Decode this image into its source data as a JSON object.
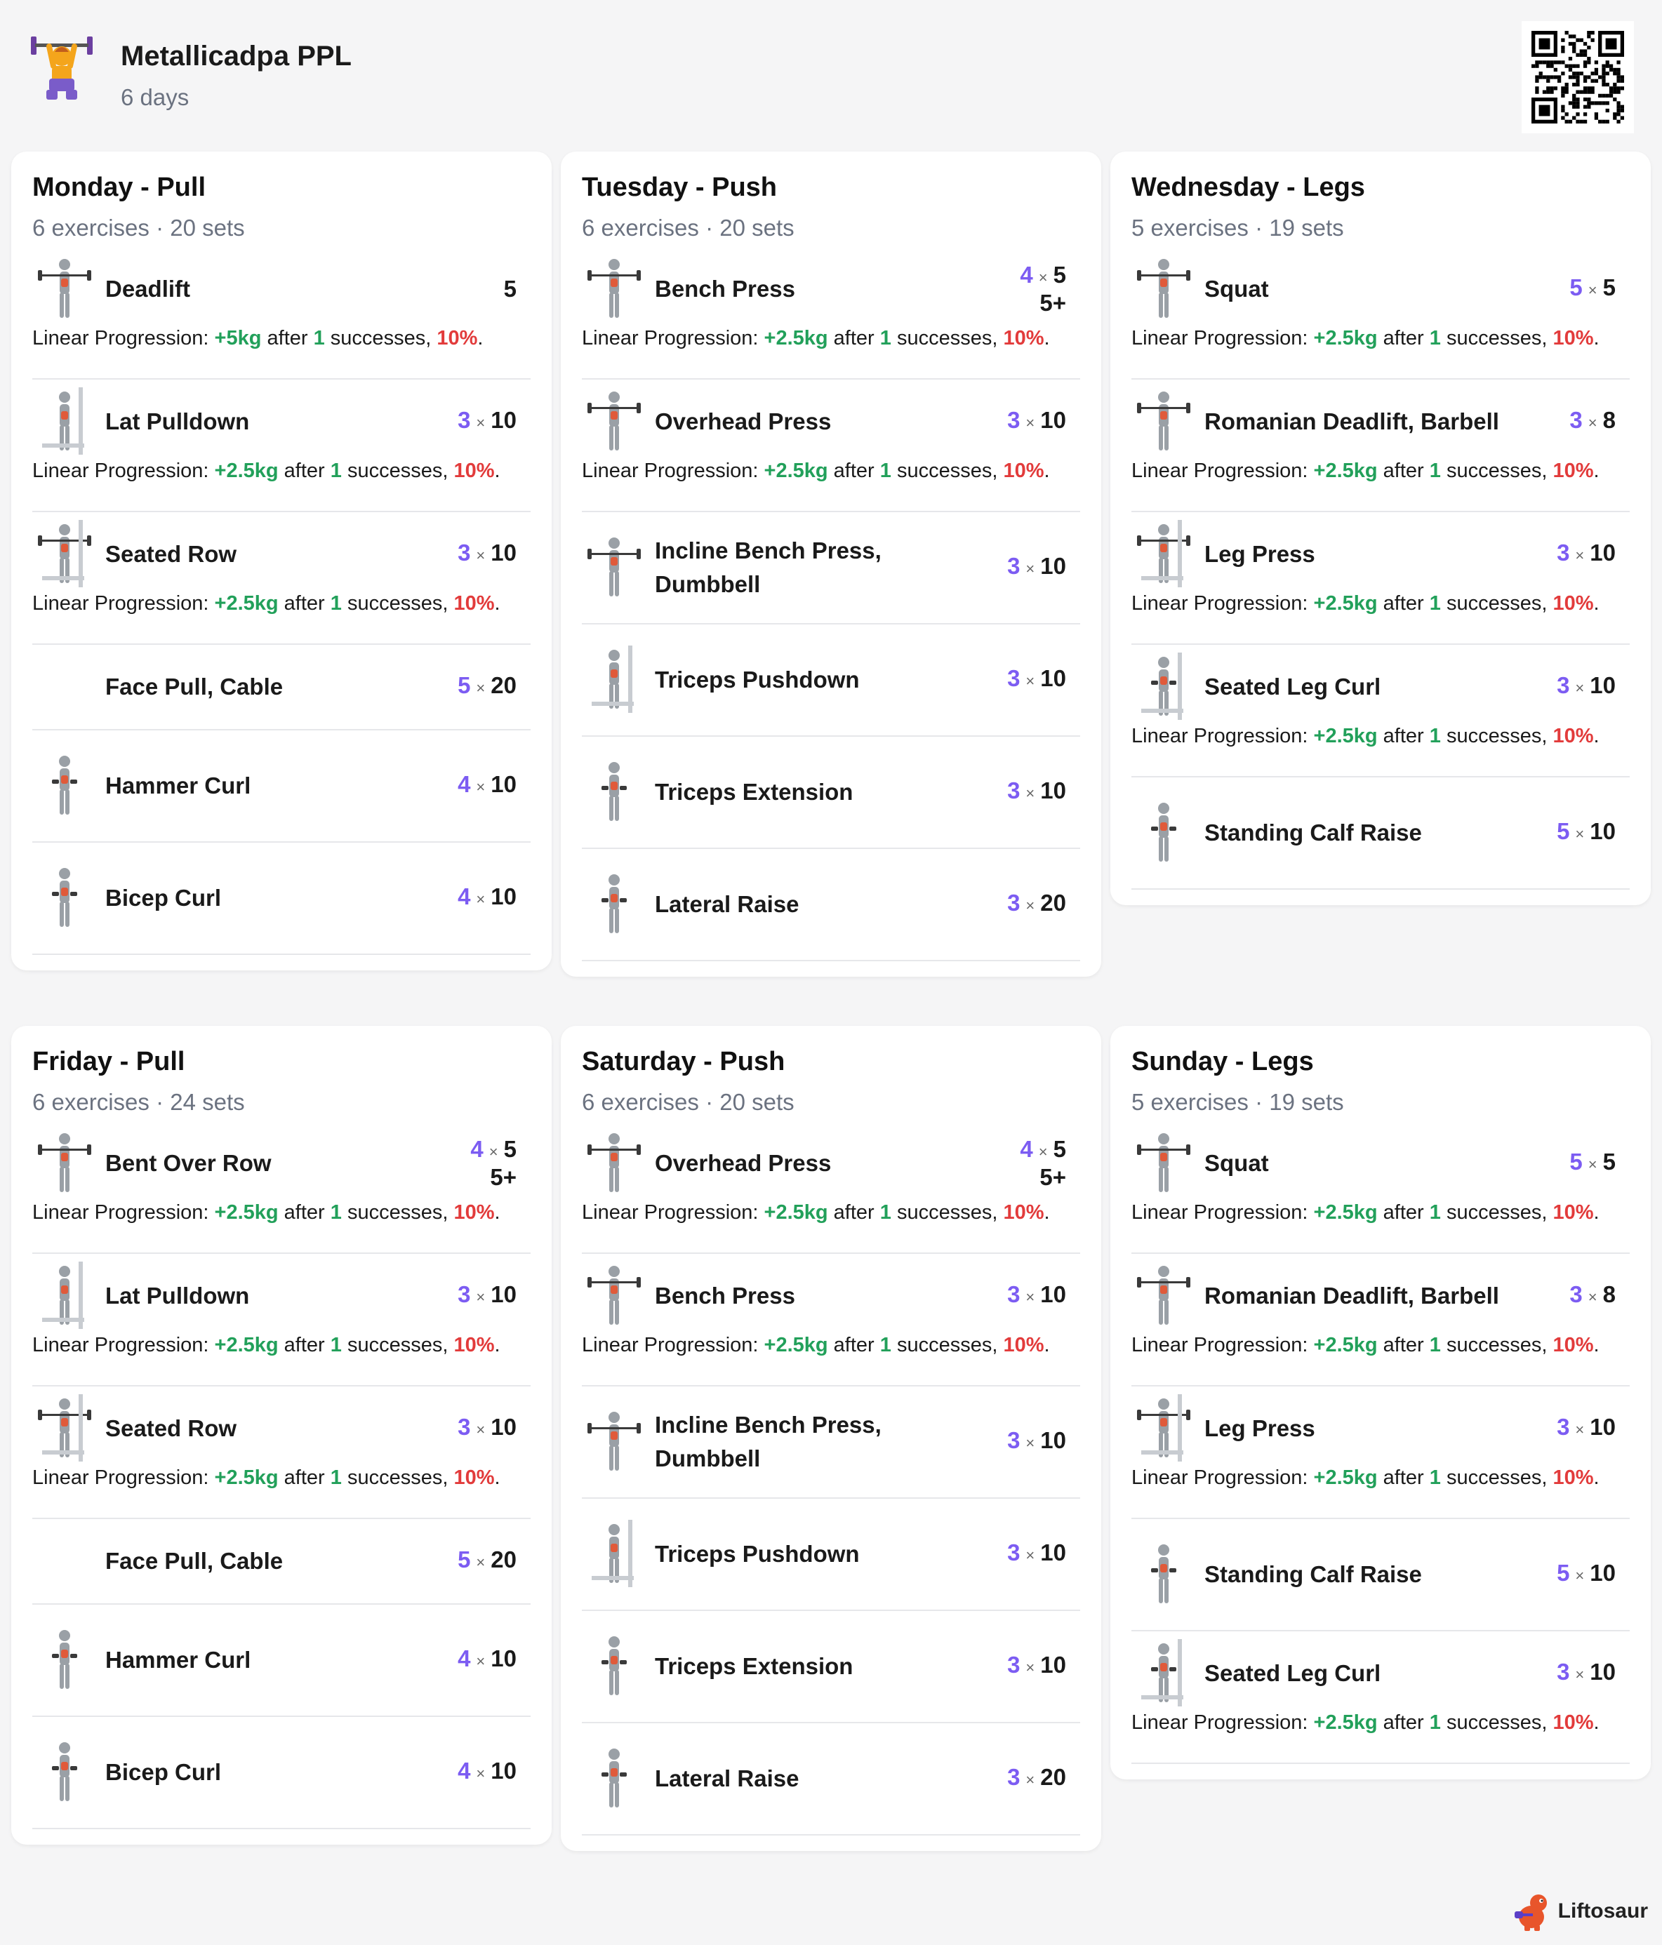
{
  "program": {
    "title": "Metallicadpa PPL",
    "subtitle": "6 days"
  },
  "brand": "Liftosaur",
  "x_sign": "×",
  "prog_text": {
    "prefix": "Linear Progression: ",
    "after": " after ",
    "successes": " successes, ",
    "one": "1",
    "pct": "10%",
    "dot": "."
  },
  "days": [
    {
      "title": "Monday - Pull",
      "meta": "6 exercises · 20 sets",
      "exercises": [
        {
          "name": "Deadlift",
          "sets": "",
          "reps": "5",
          "extra": "",
          "prog": "+5kg",
          "icon": "deadlift-icon"
        },
        {
          "name": "Lat Pulldown",
          "sets": "3",
          "reps": "10",
          "extra": "",
          "prog": "+2.5kg",
          "icon": "lat-pulldown-icon"
        },
        {
          "name": "Seated Row",
          "sets": "3",
          "reps": "10",
          "extra": "",
          "prog": "+2.5kg",
          "icon": "seated-row-icon"
        },
        {
          "name": "Face Pull, Cable",
          "sets": "5",
          "reps": "20",
          "extra": "",
          "prog": "",
          "icon": ""
        },
        {
          "name": "Hammer Curl",
          "sets": "4",
          "reps": "10",
          "extra": "",
          "prog": "",
          "icon": "hammer-curl-icon"
        },
        {
          "name": "Bicep Curl",
          "sets": "4",
          "reps": "10",
          "extra": "",
          "prog": "",
          "icon": "bicep-curl-icon"
        }
      ]
    },
    {
      "title": "Tuesday - Push",
      "meta": "6 exercises · 20 sets",
      "exercises": [
        {
          "name": "Bench Press",
          "sets": "4",
          "reps": "5",
          "extra": "5+",
          "prog": "+2.5kg",
          "icon": "bench-press-icon"
        },
        {
          "name": "Overhead Press",
          "sets": "3",
          "reps": "10",
          "extra": "",
          "prog": "+2.5kg",
          "icon": "overhead-press-icon"
        },
        {
          "name": "Incline Bench Press, Dumbbell",
          "sets": "3",
          "reps": "10",
          "extra": "",
          "prog": "",
          "icon": "incline-press-icon"
        },
        {
          "name": "Triceps Pushdown",
          "sets": "3",
          "reps": "10",
          "extra": "",
          "prog": "",
          "icon": "triceps-pushdown-icon"
        },
        {
          "name": "Triceps Extension",
          "sets": "3",
          "reps": "10",
          "extra": "",
          "prog": "",
          "icon": "triceps-extension-icon"
        },
        {
          "name": "Lateral Raise",
          "sets": "3",
          "reps": "20",
          "extra": "",
          "prog": "",
          "icon": "lateral-raise-icon"
        }
      ]
    },
    {
      "title": "Wednesday - Legs",
      "meta": "5 exercises · 19 sets",
      "exercises": [
        {
          "name": "Squat",
          "sets": "5",
          "reps": "5",
          "extra": "",
          "prog": "+2.5kg",
          "icon": "squat-icon"
        },
        {
          "name": "Romanian Deadlift, Barbell",
          "sets": "3",
          "reps": "8",
          "extra": "",
          "prog": "+2.5kg",
          "icon": "romanian-deadlift-icon"
        },
        {
          "name": "Leg Press",
          "sets": "3",
          "reps": "10",
          "extra": "",
          "prog": "+2.5kg",
          "icon": "leg-press-icon"
        },
        {
          "name": "Seated Leg Curl",
          "sets": "3",
          "reps": "10",
          "extra": "",
          "prog": "+2.5kg",
          "icon": "leg-curl-icon"
        },
        {
          "name": "Standing Calf Raise",
          "sets": "5",
          "reps": "10",
          "extra": "",
          "prog": "",
          "icon": "calf-raise-icon"
        }
      ]
    },
    {
      "title": "Friday - Pull",
      "meta": "6 exercises · 24 sets",
      "exercises": [
        {
          "name": "Bent Over Row",
          "sets": "4",
          "reps": "5",
          "extra": "5+",
          "prog": "+2.5kg",
          "icon": "bent-over-row-icon"
        },
        {
          "name": "Lat Pulldown",
          "sets": "3",
          "reps": "10",
          "extra": "",
          "prog": "+2.5kg",
          "icon": "lat-pulldown-icon"
        },
        {
          "name": "Seated Row",
          "sets": "3",
          "reps": "10",
          "extra": "",
          "prog": "+2.5kg",
          "icon": "seated-row-icon"
        },
        {
          "name": "Face Pull, Cable",
          "sets": "5",
          "reps": "20",
          "extra": "",
          "prog": "",
          "icon": ""
        },
        {
          "name": "Hammer Curl",
          "sets": "4",
          "reps": "10",
          "extra": "",
          "prog": "",
          "icon": "hammer-curl-icon"
        },
        {
          "name": "Bicep Curl",
          "sets": "4",
          "reps": "10",
          "extra": "",
          "prog": "",
          "icon": "bicep-curl-icon"
        }
      ]
    },
    {
      "title": "Saturday - Push",
      "meta": "6 exercises · 20 sets",
      "exercises": [
        {
          "name": "Overhead Press",
          "sets": "4",
          "reps": "5",
          "extra": "5+",
          "prog": "+2.5kg",
          "icon": "overhead-press-icon"
        },
        {
          "name": "Bench Press",
          "sets": "3",
          "reps": "10",
          "extra": "",
          "prog": "+2.5kg",
          "icon": "bench-press-icon"
        },
        {
          "name": "Incline Bench Press, Dumbbell",
          "sets": "3",
          "reps": "10",
          "extra": "",
          "prog": "",
          "icon": "incline-press-icon"
        },
        {
          "name": "Triceps Pushdown",
          "sets": "3",
          "reps": "10",
          "extra": "",
          "prog": "",
          "icon": "triceps-pushdown-icon"
        },
        {
          "name": "Triceps Extension",
          "sets": "3",
          "reps": "10",
          "extra": "",
          "prog": "",
          "icon": "triceps-extension-icon"
        },
        {
          "name": "Lateral Raise",
          "sets": "3",
          "reps": "20",
          "extra": "",
          "prog": "",
          "icon": "lateral-raise-icon"
        }
      ]
    },
    {
      "title": "Sunday - Legs",
      "meta": "5 exercises · 19 sets",
      "exercises": [
        {
          "name": "Squat",
          "sets": "5",
          "reps": "5",
          "extra": "",
          "prog": "+2.5kg",
          "icon": "squat-icon"
        },
        {
          "name": "Romanian Deadlift, Barbell",
          "sets": "3",
          "reps": "8",
          "extra": "",
          "prog": "+2.5kg",
          "icon": "romanian-deadlift-icon"
        },
        {
          "name": "Leg Press",
          "sets": "3",
          "reps": "10",
          "extra": "",
          "prog": "+2.5kg",
          "icon": "leg-press-icon"
        },
        {
          "name": "Standing Calf Raise",
          "sets": "5",
          "reps": "10",
          "extra": "",
          "prog": "",
          "icon": "calf-raise-icon"
        },
        {
          "name": "Seated Leg Curl",
          "sets": "3",
          "reps": "10",
          "extra": "",
          "prog": "+2.5kg",
          "icon": "leg-curl-icon"
        }
      ]
    }
  ]
}
